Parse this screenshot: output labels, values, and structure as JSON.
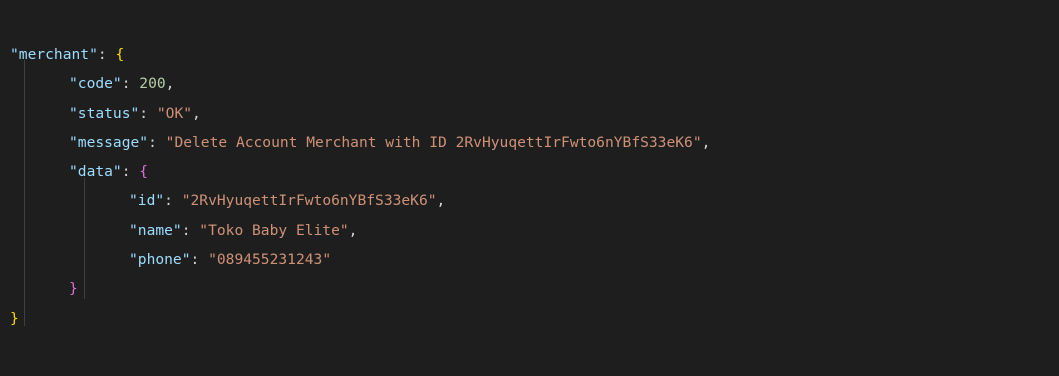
{
  "colors": {
    "background": "#1e1e1e",
    "key": "#9cdcfe",
    "string": "#ce9178",
    "number": "#b5cea8",
    "punctuation": "#d4d4d4",
    "brace_outer": "#ffd700",
    "brace_inner": "#da70d6"
  },
  "code": {
    "root_key": "\"merchant\"",
    "root_open": "{",
    "code_key": "\"code\"",
    "code_value": "200",
    "status_key": "\"status\"",
    "status_value": "\"OK\"",
    "message_key": "\"message\"",
    "message_value": "\"Delete Account Merchant with ID 2RvHyuqettIrFwto6nYBfS33eK6\"",
    "data_key": "\"data\"",
    "data_open": "{",
    "id_key": "\"id\"",
    "id_value": "\"2RvHyuqettIrFwto6nYBfS33eK6\"",
    "name_key": "\"name\"",
    "name_value": "\"Toko Baby Elite\"",
    "phone_key": "\"phone\"",
    "phone_value": "\"089455231243\"",
    "data_close": "}",
    "root_close": "}"
  }
}
